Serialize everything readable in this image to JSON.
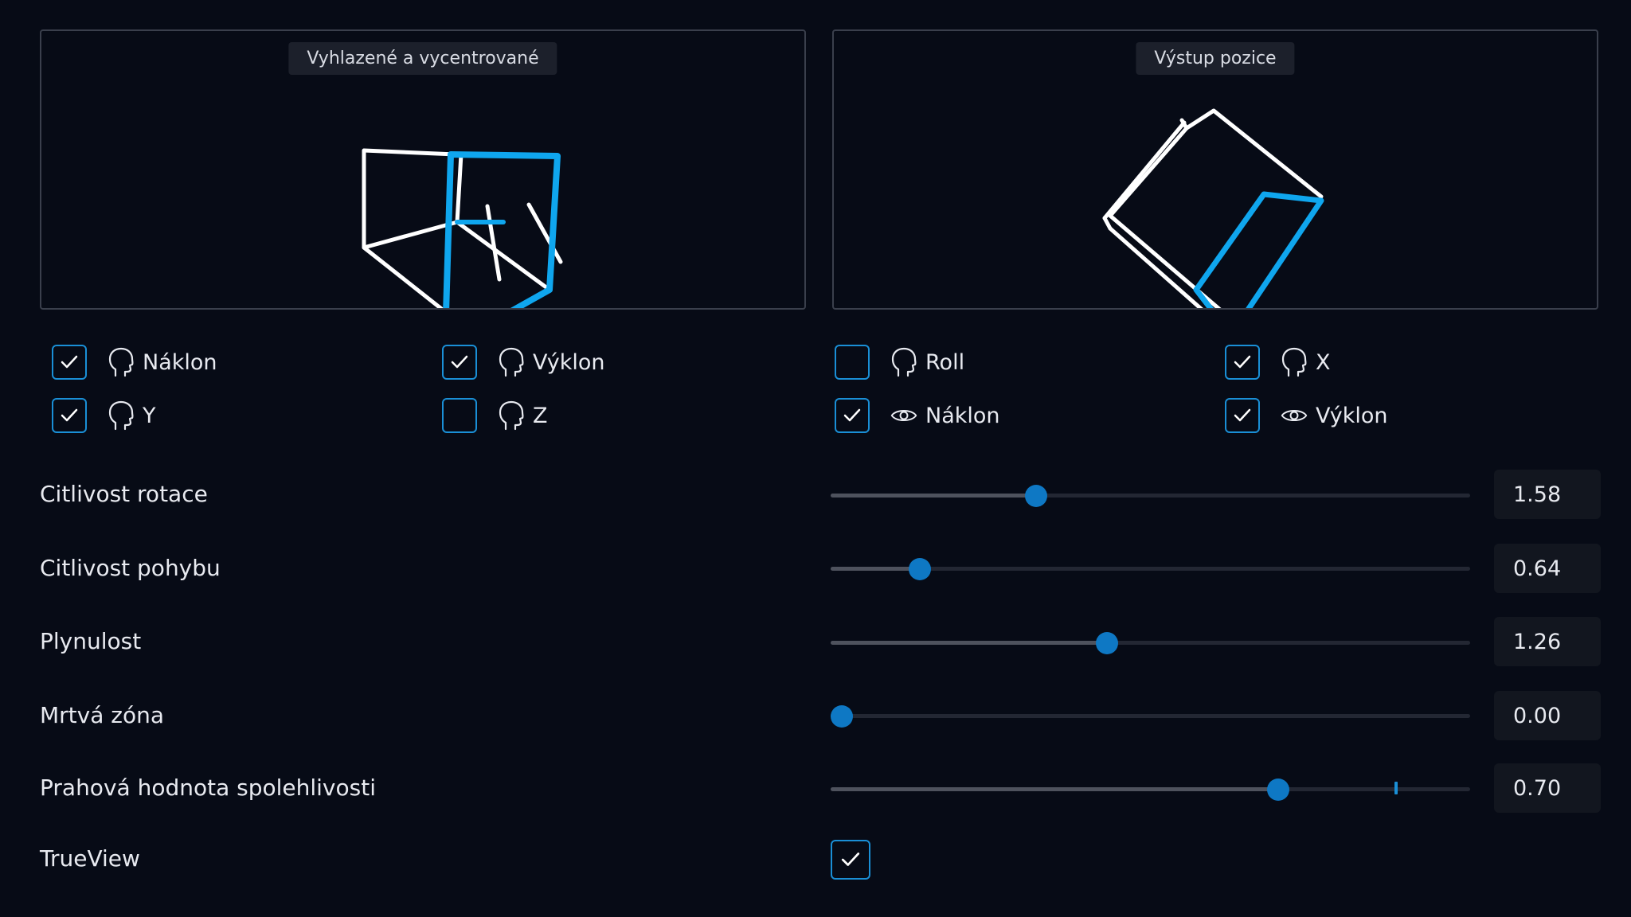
{
  "previews": {
    "left_label": "Vyhlazené a vycentrované",
    "right_label": "Výstup pozice"
  },
  "colors": {
    "accent": "#1a8fd6",
    "thumb": "#0e78c4",
    "background": "#070b16",
    "cube_white": "#ffffff",
    "cube_blue": "#0fa6ee"
  },
  "options": [
    {
      "label": "Náklon",
      "checked": true,
      "icon": "head-icon"
    },
    {
      "label": "Výklon",
      "checked": true,
      "icon": "head-icon"
    },
    {
      "label": "Roll",
      "checked": false,
      "icon": "head-icon"
    },
    {
      "label": "X",
      "checked": true,
      "icon": "head-icon"
    },
    {
      "label": "Y",
      "checked": true,
      "icon": "head-icon"
    },
    {
      "label": "Z",
      "checked": false,
      "icon": "head-icon"
    },
    {
      "label": "Náklon",
      "checked": true,
      "icon": "eye-icon"
    },
    {
      "label": "Výklon",
      "checked": true,
      "icon": "eye-icon"
    }
  ],
  "settings": [
    {
      "label": "Citlivost rotace",
      "value": "1.58",
      "fraction": 0.315
    },
    {
      "label": "Citlivost pohybu",
      "value": "0.64",
      "fraction": 0.127
    },
    {
      "label": "Plynulost",
      "value": "1.26",
      "fraction": 0.43
    },
    {
      "label": "Mrtvá zóna",
      "value": "0.00",
      "fraction": 0.0
    },
    {
      "label": "Prahová hodnota spolehlivosti",
      "value": "0.70",
      "fraction": 0.707,
      "marker_fraction": 0.898
    }
  ],
  "trueview": {
    "label": "TrueView",
    "checked": true
  }
}
